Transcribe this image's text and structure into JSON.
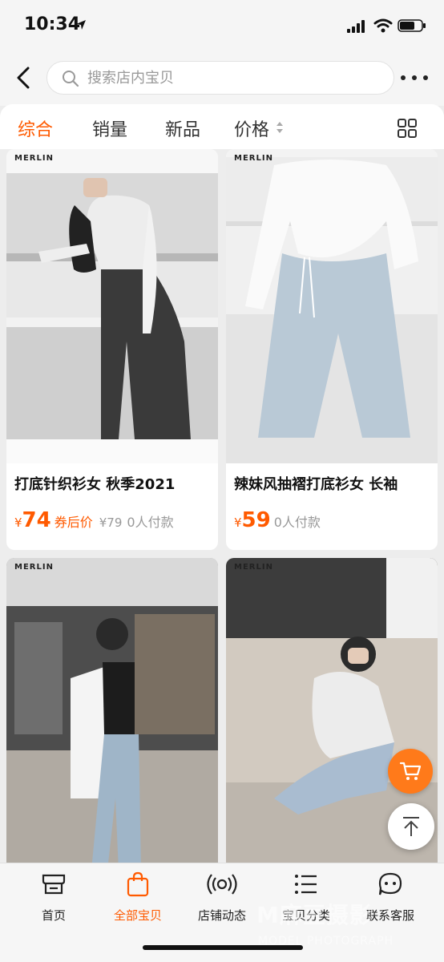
{
  "status": {
    "time": "10:34"
  },
  "search": {
    "placeholder": "搜索店内宝贝"
  },
  "sort_tabs": [
    {
      "label": "综合",
      "active": true
    },
    {
      "label": "销量",
      "active": false
    },
    {
      "label": "新品",
      "active": false
    },
    {
      "label": "价格",
      "active": false
    }
  ],
  "products": [
    {
      "brand": "MERLIN",
      "title": "打底针织衫女 秋季2021",
      "currency": "¥",
      "price": "74",
      "coupon_label": "券后价",
      "original_price": "¥79",
      "paid": "0人付款"
    },
    {
      "brand": "MERLIN",
      "title": "辣妹风抽褶打底衫女 长袖",
      "currency": "¥",
      "price": "59",
      "paid": "0人付款"
    },
    {
      "brand": "MERLIN"
    },
    {
      "brand": "MERLIN"
    }
  ],
  "bottom_tabs": [
    {
      "label": "首页",
      "icon": "shop-icon",
      "active": false
    },
    {
      "label": "全部宝贝",
      "icon": "bag-icon",
      "active": true
    },
    {
      "label": "店铺动态",
      "icon": "broadcast-icon",
      "active": false
    },
    {
      "label": "宝贝分类",
      "icon": "list-icon",
      "active": false
    },
    {
      "label": "联系客服",
      "icon": "chat-bubble-icon",
      "active": false
    }
  ],
  "watermark": {
    "text": "M麻豆摄影",
    "sub": "MODEL PHOTOGRAPH"
  },
  "colors": {
    "accent": "#ff5a00",
    "background": "#ededed"
  }
}
